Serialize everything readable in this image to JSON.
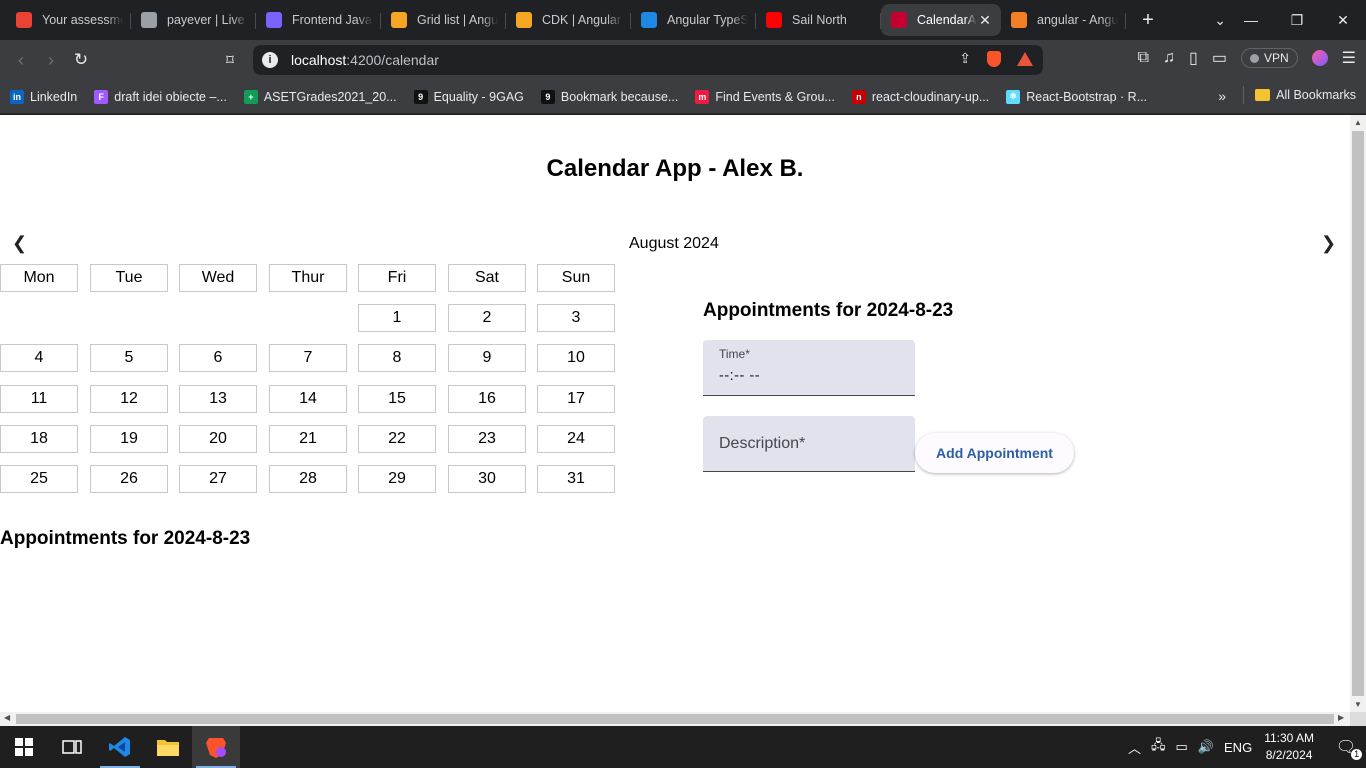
{
  "browser": {
    "tabs": [
      {
        "title": "Your assessment",
        "favicon": "gmail-icon",
        "color": "#ea4335"
      },
      {
        "title": "payever | Live",
        "favicon": "record-icon",
        "color": "#9aa0a6"
      },
      {
        "title": "Frontend JavaScript",
        "favicon": "list-icon",
        "color": "#7b61ff"
      },
      {
        "title": "Grid list | Angular",
        "favicon": "shield-icon",
        "color": "#f5a623"
      },
      {
        "title": "CDK | Angular",
        "favicon": "shield-icon",
        "color": "#f5a623"
      },
      {
        "title": "Angular TypeScript",
        "favicon": "vscode-icon",
        "color": "#1e88e5"
      },
      {
        "title": "Sail North",
        "favicon": "youtube-icon",
        "color": "#ff0000"
      },
      {
        "title": "CalendarApp",
        "favicon": "angular-icon",
        "color": "#c3002f",
        "active": true
      },
      {
        "title": "angular - Angular",
        "favicon": "stackoverflow-icon",
        "color": "#f48024"
      }
    ],
    "url_host": "localhost",
    "url_path": ":4200/calendar",
    "vpn_label": "VPN",
    "bookmarks": [
      {
        "label": "LinkedIn",
        "color": "#0a66c2",
        "glyph": "in"
      },
      {
        "label": "draft idei obiecte –...",
        "color": "#a259ff",
        "glyph": "F"
      },
      {
        "label": "ASETGrades2021_20...",
        "color": "#0f9d58",
        "glyph": "+"
      },
      {
        "label": "Equality - 9GAG",
        "color": "#111111",
        "glyph": "9"
      },
      {
        "label": "Bookmark because...",
        "color": "#111111",
        "glyph": "9"
      },
      {
        "label": "Find Events & Grou...",
        "color": "#ed1c40",
        "glyph": "m"
      },
      {
        "label": "react-cloudinary-up...",
        "color": "#c60000",
        "glyph": "n"
      },
      {
        "label": "React-Bootstrap · R...",
        "color": "#61dafb",
        "glyph": "⚛"
      }
    ],
    "all_bookmarks_label": "All Bookmarks"
  },
  "page": {
    "title": "Calendar App - Alex B.",
    "month_label": "August 2024",
    "weekdays": [
      "Mon",
      "Tue",
      "Wed",
      "Thur",
      "Fri",
      "Sat",
      "Sun"
    ],
    "first_weekday_index": 4,
    "days_in_month": 31,
    "appointments_heading": "Appointments for 2024-8-23",
    "form": {
      "time_label": "Time*",
      "time_value": "--:-- --",
      "description_label": "Description*",
      "add_button": "Add Appointment"
    }
  },
  "taskbar": {
    "language": "ENG",
    "time": "11:30 AM",
    "date": "8/2/2024",
    "notification_count": "1"
  }
}
